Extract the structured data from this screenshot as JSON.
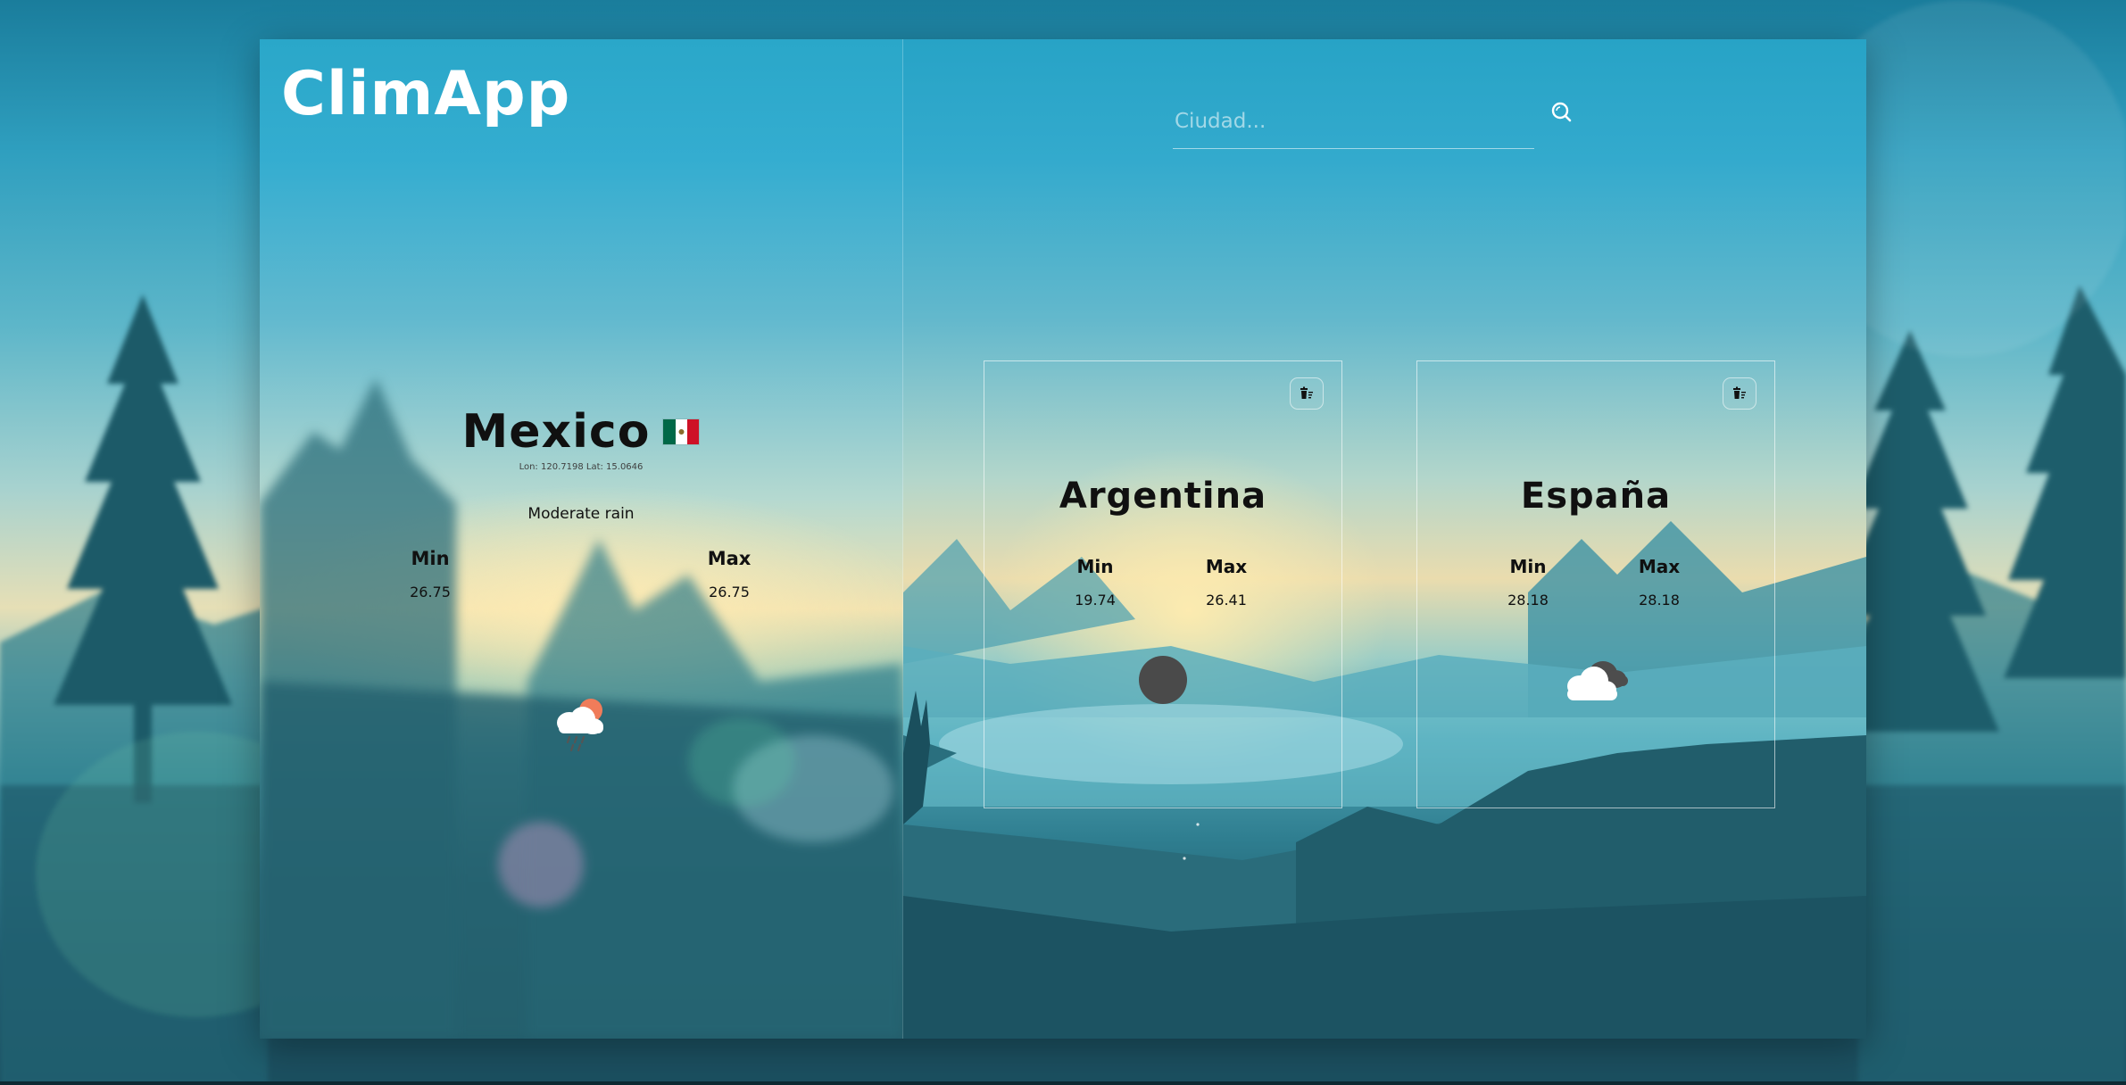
{
  "app": {
    "title": "ClimApp"
  },
  "search": {
    "placeholder": "Ciudad..."
  },
  "current": {
    "city": "Mexico",
    "flag": {
      "icon": "mexico-flag-icon",
      "colors": [
        "#006847",
        "#ffffff",
        "#ce1126"
      ]
    },
    "coords": "Lon: 120.7198 Lat: 15.0646",
    "description": "Moderate rain",
    "min_label": "Min",
    "min_value": "26.75",
    "max_label": "Max",
    "max_value": "26.75",
    "icon": "cloud-sun-rain-icon"
  },
  "cards": [
    {
      "city": "Argentina",
      "min_label": "Min",
      "min_value": "19.74",
      "max_label": "Max",
      "max_value": "26.41",
      "icon": "dark-circle-icon",
      "delete_icon": "trash-icon"
    },
    {
      "city": "España",
      "min_label": "Min",
      "min_value": "28.18",
      "max_label": "Max",
      "max_value": "28.18",
      "icon": "cloudy-icon",
      "delete_icon": "trash-icon"
    }
  ],
  "colors": {
    "text": "#101010",
    "logo": "#ffffff",
    "card_border": "rgba(255,255,255,0.6)"
  }
}
